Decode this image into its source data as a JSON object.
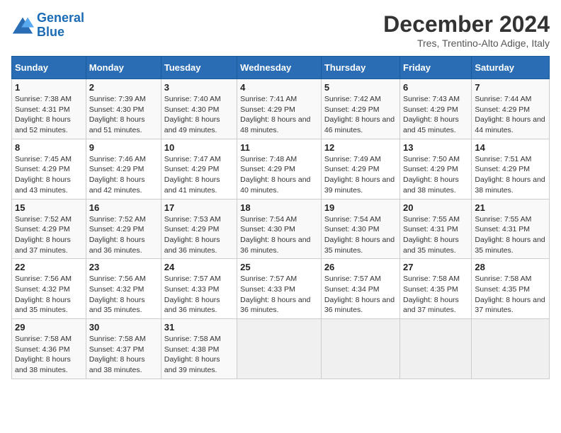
{
  "header": {
    "logo_line1": "General",
    "logo_line2": "Blue",
    "title": "December 2024",
    "subtitle": "Tres, Trentino-Alto Adige, Italy"
  },
  "days_of_week": [
    "Sunday",
    "Monday",
    "Tuesday",
    "Wednesday",
    "Thursday",
    "Friday",
    "Saturday"
  ],
  "weeks": [
    [
      {
        "day": 1,
        "sunrise": "7:38 AM",
        "sunset": "4:31 PM",
        "daylight": "8 hours and 52 minutes."
      },
      {
        "day": 2,
        "sunrise": "7:39 AM",
        "sunset": "4:30 PM",
        "daylight": "8 hours and 51 minutes."
      },
      {
        "day": 3,
        "sunrise": "7:40 AM",
        "sunset": "4:30 PM",
        "daylight": "8 hours and 49 minutes."
      },
      {
        "day": 4,
        "sunrise": "7:41 AM",
        "sunset": "4:29 PM",
        "daylight": "8 hours and 48 minutes."
      },
      {
        "day": 5,
        "sunrise": "7:42 AM",
        "sunset": "4:29 PM",
        "daylight": "8 hours and 46 minutes."
      },
      {
        "day": 6,
        "sunrise": "7:43 AM",
        "sunset": "4:29 PM",
        "daylight": "8 hours and 45 minutes."
      },
      {
        "day": 7,
        "sunrise": "7:44 AM",
        "sunset": "4:29 PM",
        "daylight": "8 hours and 44 minutes."
      }
    ],
    [
      {
        "day": 8,
        "sunrise": "7:45 AM",
        "sunset": "4:29 PM",
        "daylight": "8 hours and 43 minutes."
      },
      {
        "day": 9,
        "sunrise": "7:46 AM",
        "sunset": "4:29 PM",
        "daylight": "8 hours and 42 minutes."
      },
      {
        "day": 10,
        "sunrise": "7:47 AM",
        "sunset": "4:29 PM",
        "daylight": "8 hours and 41 minutes."
      },
      {
        "day": 11,
        "sunrise": "7:48 AM",
        "sunset": "4:29 PM",
        "daylight": "8 hours and 40 minutes."
      },
      {
        "day": 12,
        "sunrise": "7:49 AM",
        "sunset": "4:29 PM",
        "daylight": "8 hours and 39 minutes."
      },
      {
        "day": 13,
        "sunrise": "7:50 AM",
        "sunset": "4:29 PM",
        "daylight": "8 hours and 38 minutes."
      },
      {
        "day": 14,
        "sunrise": "7:51 AM",
        "sunset": "4:29 PM",
        "daylight": "8 hours and 38 minutes."
      }
    ],
    [
      {
        "day": 15,
        "sunrise": "7:52 AM",
        "sunset": "4:29 PM",
        "daylight": "8 hours and 37 minutes."
      },
      {
        "day": 16,
        "sunrise": "7:52 AM",
        "sunset": "4:29 PM",
        "daylight": "8 hours and 36 minutes."
      },
      {
        "day": 17,
        "sunrise": "7:53 AM",
        "sunset": "4:29 PM",
        "daylight": "8 hours and 36 minutes."
      },
      {
        "day": 18,
        "sunrise": "7:54 AM",
        "sunset": "4:30 PM",
        "daylight": "8 hours and 36 minutes."
      },
      {
        "day": 19,
        "sunrise": "7:54 AM",
        "sunset": "4:30 PM",
        "daylight": "8 hours and 35 minutes."
      },
      {
        "day": 20,
        "sunrise": "7:55 AM",
        "sunset": "4:31 PM",
        "daylight": "8 hours and 35 minutes."
      },
      {
        "day": 21,
        "sunrise": "7:55 AM",
        "sunset": "4:31 PM",
        "daylight": "8 hours and 35 minutes."
      }
    ],
    [
      {
        "day": 22,
        "sunrise": "7:56 AM",
        "sunset": "4:32 PM",
        "daylight": "8 hours and 35 minutes."
      },
      {
        "day": 23,
        "sunrise": "7:56 AM",
        "sunset": "4:32 PM",
        "daylight": "8 hours and 35 minutes."
      },
      {
        "day": 24,
        "sunrise": "7:57 AM",
        "sunset": "4:33 PM",
        "daylight": "8 hours and 36 minutes."
      },
      {
        "day": 25,
        "sunrise": "7:57 AM",
        "sunset": "4:33 PM",
        "daylight": "8 hours and 36 minutes."
      },
      {
        "day": 26,
        "sunrise": "7:57 AM",
        "sunset": "4:34 PM",
        "daylight": "8 hours and 36 minutes."
      },
      {
        "day": 27,
        "sunrise": "7:58 AM",
        "sunset": "4:35 PM",
        "daylight": "8 hours and 37 minutes."
      },
      {
        "day": 28,
        "sunrise": "7:58 AM",
        "sunset": "4:35 PM",
        "daylight": "8 hours and 37 minutes."
      }
    ],
    [
      {
        "day": 29,
        "sunrise": "7:58 AM",
        "sunset": "4:36 PM",
        "daylight": "8 hours and 38 minutes."
      },
      {
        "day": 30,
        "sunrise": "7:58 AM",
        "sunset": "4:37 PM",
        "daylight": "8 hours and 38 minutes."
      },
      {
        "day": 31,
        "sunrise": "7:58 AM",
        "sunset": "4:38 PM",
        "daylight": "8 hours and 39 minutes."
      },
      null,
      null,
      null,
      null
    ]
  ]
}
